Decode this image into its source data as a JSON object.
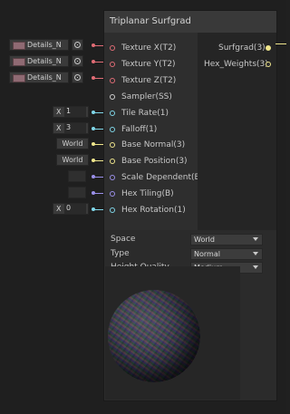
{
  "node": {
    "title": "Triplanar Surfgrad",
    "inputs": [
      {
        "label": "Texture X(T2)",
        "color": "#e06c75"
      },
      {
        "label": "Texture Y(T2)",
        "color": "#e06c75"
      },
      {
        "label": "Texture Z(T2)",
        "color": "#e06c75"
      },
      {
        "label": "Sampler(SS)",
        "color": "#cfcfcf"
      },
      {
        "label": "Tile Rate(1)",
        "color": "#7fd6e8"
      },
      {
        "label": "Falloff(1)",
        "color": "#7fd6e8"
      },
      {
        "label": "Base Normal(3)",
        "color": "#f0e68c"
      },
      {
        "label": "Base Position(3)",
        "color": "#f0e68c"
      },
      {
        "label": "Scale Dependent(B)",
        "color": "#9a8fe8"
      },
      {
        "label": "Hex Tiling(B)",
        "color": "#9a8fe8"
      },
      {
        "label": "Hex Rotation(1)",
        "color": "#7fd6e8"
      }
    ],
    "outputs": [
      {
        "label": "Surfgrad(3)",
        "color": "#f0e68c"
      },
      {
        "label": "Hex_Weights(3)",
        "color": "#f0e68c"
      }
    ],
    "settings": [
      {
        "label": "Space",
        "value": "World"
      },
      {
        "label": "Type",
        "value": "Normal"
      },
      {
        "label": "Height Quality",
        "value": "Medium"
      }
    ]
  },
  "external_inputs": {
    "textures": [
      "Details_N",
      "Details_N",
      "Details_N"
    ],
    "tile_rate": {
      "axis": "X",
      "value": "1"
    },
    "falloff": {
      "axis": "X",
      "value": "3"
    },
    "base_normal": "World",
    "base_position": "World",
    "hex_rotation": {
      "axis": "X",
      "value": "0"
    }
  }
}
